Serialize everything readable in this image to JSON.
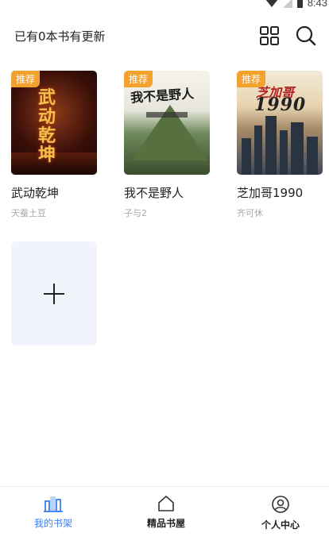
{
  "status_bar": {
    "time": "8:43"
  },
  "header": {
    "update_text": "已有0本书有更新"
  },
  "books": [
    {
      "tag": "推荐",
      "cover_title": "武动乾坤",
      "title": "武动乾坤",
      "author": "天蚕土豆"
    },
    {
      "tag": "推荐",
      "cover_title": "我不是野人",
      "title": "我不是野人",
      "author": "子与2"
    },
    {
      "tag": "推荐",
      "cover_title": "芝加哥",
      "cover_year": "1990",
      "title": "芝加哥1990",
      "author": "齐可休"
    }
  ],
  "bottom_nav": {
    "items": [
      {
        "label": "我的书架",
        "active": true
      },
      {
        "label": "精品书屋",
        "active": false
      },
      {
        "label": "个人中心",
        "active": false
      }
    ]
  },
  "colors": {
    "accent": "#3d7ff3",
    "tag": "#f5a12e",
    "author": "#a8a8a8",
    "add_card_bg": "#f1f4fb"
  },
  "icons": [
    "grid-icon",
    "search-icon",
    "plus-icon",
    "bookshelf-icon",
    "home-icon",
    "user-icon"
  ]
}
